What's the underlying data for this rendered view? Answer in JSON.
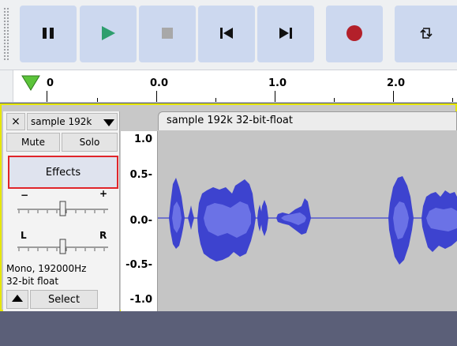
{
  "toolbar": {
    "buttons": [
      {
        "name": "pause",
        "icon": "pause-icon",
        "color": "#111111"
      },
      {
        "name": "play",
        "icon": "play-icon",
        "color": "#2e9e6e"
      },
      {
        "name": "stop",
        "icon": "stop-icon",
        "color": "#a8a8a8"
      },
      {
        "name": "skip-to-start",
        "icon": "skip-start-icon",
        "color": "#111111"
      },
      {
        "name": "skip-to-end",
        "icon": "skip-end-icon",
        "color": "#111111"
      },
      {
        "name": "record",
        "icon": "record-icon",
        "color": "#b3202a"
      },
      {
        "name": "loop",
        "icon": "loop-icon",
        "color": "#111111"
      }
    ]
  },
  "ruler": {
    "labels": [
      "0",
      "0.0",
      "1.0",
      "2.0"
    ],
    "playhead_icon": "play-head-triangle-icon",
    "playhead_color": "#5cc43a"
  },
  "track": {
    "close_label": "×",
    "name": "sample 192k",
    "menu_icon": "dropdown-triangle-icon",
    "mute_label": "Mute",
    "solo_label": "Solo",
    "effects_label": "Effects",
    "gain_minus": "−",
    "gain_plus": "+",
    "pan_left": "L",
    "pan_right": "R",
    "info_line1": "Mono, 192000Hz",
    "info_line2": "32-bit float",
    "collapse_icon": "collapse-arrow-icon",
    "select_label": "Select",
    "gain_level": 0.5,
    "pan_level": 0.5
  },
  "vertical_ruler": {
    "labels": [
      "1.0",
      "0.5-",
      "0.0-",
      "-0.5-",
      "-1.0"
    ]
  },
  "clip": {
    "title": "sample 192k 32-bit-float",
    "waveform_color": "#3d43cf",
    "rms_color": "#6b72e6",
    "highlight_color": "#e0252a",
    "selection_border": "#e6e600"
  }
}
